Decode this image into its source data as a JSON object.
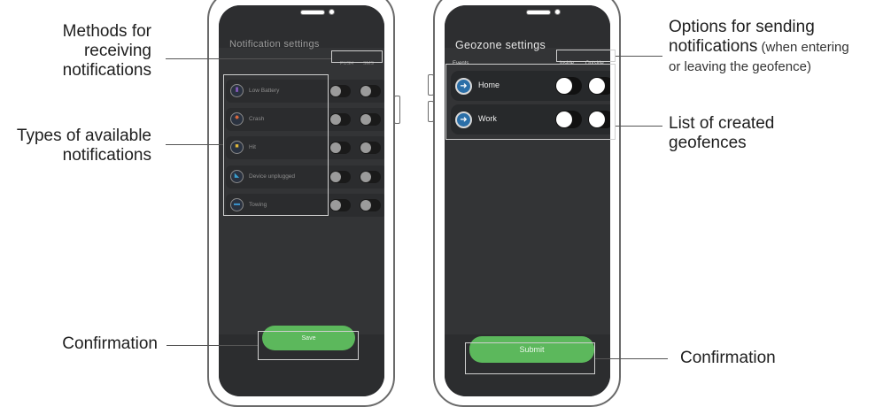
{
  "left_phone": {
    "title": "Notification settings",
    "columns": [
      "PUSH",
      "SMS"
    ],
    "notification_types": [
      {
        "label": "Low Battery",
        "icon": "battery-icon",
        "icon_color": "#8a5cc2"
      },
      {
        "label": "Crash",
        "icon": "crash-icon",
        "icon_color": "#d8683c"
      },
      {
        "label": "Hit",
        "icon": "hit-icon",
        "icon_color": "#e0b83a"
      },
      {
        "label": "Device unplugged",
        "icon": "plug-icon",
        "icon_color": "#3aa0d0"
      },
      {
        "label": "Towing",
        "icon": "tow-truck-icon",
        "icon_color": "#3a8fc7"
      }
    ],
    "save_label": "Save"
  },
  "right_phone": {
    "title": "Geozone settings",
    "events_label": "Events",
    "columns": [
      "Inside",
      "Outside"
    ],
    "geofences": [
      {
        "label": "Home",
        "icon": "geofence-icon"
      },
      {
        "label": "Work",
        "icon": "geofence-icon"
      }
    ],
    "submit_label": "Submit"
  },
  "annotations": {
    "methods_line1": "Methods for",
    "methods_line2": "receiving",
    "methods_line3": "notifications",
    "types_line1": "Types of available",
    "types_line2": "notifications",
    "confirmation_left": "Confirmation",
    "options_line1": "Options for sending",
    "options_line2a": "notifications",
    "options_line2b": " (when entering",
    "options_line3": "or leaving the geofence)",
    "list_line1": "List of created",
    "list_line2": "geofences",
    "confirmation_right": "Confirmation"
  },
  "colors": {
    "accent_green": "#5cb85c",
    "screen_dark": "#333436",
    "geofence_blue": "#2b6fa8"
  }
}
